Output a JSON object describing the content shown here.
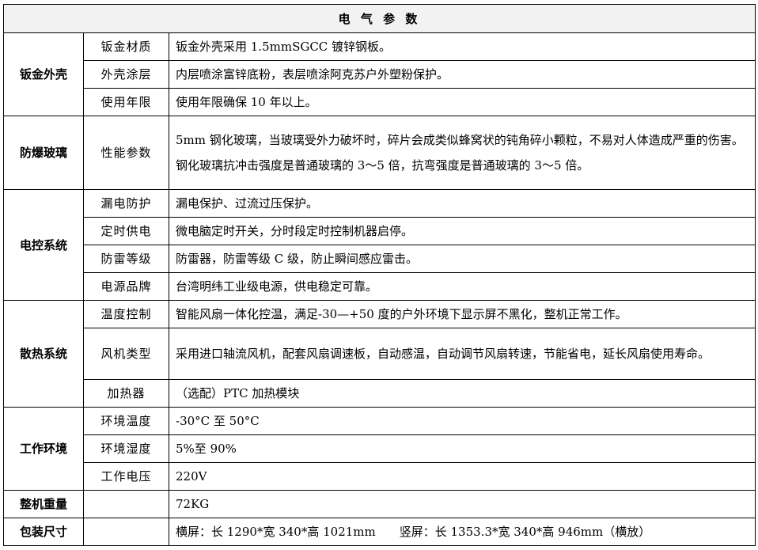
{
  "title": "电 气 参 数",
  "sections": [
    {
      "category": "钣金外壳",
      "rows": [
        {
          "label": "钣金材质",
          "value": "钣金外壳采用 1.5mmSGCC 镀锌钢板。"
        },
        {
          "label": "外壳涂层",
          "value": "内层喷涂富锌底粉，表层喷涂阿克苏户外塑粉保护。"
        },
        {
          "label": "使用年限",
          "value": "使用年限确保 10 年以上。"
        }
      ]
    },
    {
      "category": "防爆玻璃",
      "rows": [
        {
          "label": "性能参数",
          "value": "5mm 钢化玻璃，当玻璃受外力破坏时，碎片会成类似蜂窝状的钝角碎小颗粒，不易对人体造成严重的伤害。钢化玻璃抗冲击强度是普通玻璃的 3～5 倍，抗弯强度是普通玻璃的 3～5 倍。"
        }
      ]
    },
    {
      "category": "电控系统",
      "rows": [
        {
          "label": "漏电防护",
          "value": "漏电保护、过流过压保护。"
        },
        {
          "label": "定时供电",
          "value": "微电脑定时开关，分时段定时控制机器启停。"
        },
        {
          "label": "防雷等级",
          "value": "防雷器，防雷等级 C 级，防止瞬间感应雷击。"
        },
        {
          "label": "电源品牌",
          "value": "台湾明纬工业级电源，供电稳定可靠。"
        }
      ]
    },
    {
      "category": "散热系统",
      "rows": [
        {
          "label": "温度控制",
          "value": "智能风扇一体化控温，满足-30—+50 度的户外环境下显示屏不黑化，整机正常工作。"
        },
        {
          "label": "风机类型",
          "value": "采用进口轴流风机，配套风扇调速板，自动感温，自动调节风扇转速，节能省电，延长风扇使用寿命。"
        },
        {
          "label": "加热器",
          "value": "（选配）PTC 加热模块"
        }
      ]
    },
    {
      "category": "工作环境",
      "rows": [
        {
          "label": "环境温度",
          "value": "-30°C 至 50°C"
        },
        {
          "label": "环境湿度",
          "value": "5%至 90%"
        },
        {
          "label": "工作电压",
          "value": "220V"
        }
      ]
    }
  ],
  "weight": {
    "category": "整机重量",
    "label": "",
    "value": "72KG"
  },
  "packing": {
    "category": "包装尺寸",
    "label": "",
    "value": "横屏：长 1290*宽 340*高 1021mm　　竖屏：长 1353.3*宽 340*高 946mm（横放）"
  }
}
